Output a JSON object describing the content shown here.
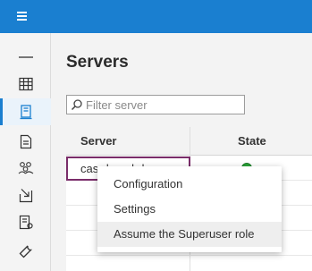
{
  "page": {
    "title": "Servers",
    "filter_placeholder": "Filter server"
  },
  "icons": {
    "menu": "hamburger-icon",
    "sidebar": [
      "collapse-icon",
      "table-icon",
      "server-icon",
      "document-icon",
      "users-icon",
      "download-icon",
      "report-icon",
      "wrench-icon"
    ]
  },
  "table": {
    "columns": [
      "Server",
      "State"
    ],
    "rows": [
      {
        "server": "cas-dev-ebde",
        "state_color": "#2aa437"
      }
    ]
  },
  "context_menu": {
    "items": [
      "Configuration",
      "Settings",
      "Assume the Superuser role"
    ]
  },
  "colors": {
    "topbar": "#1a7fd0",
    "accent": "#1a7fd0",
    "focus_border": "#7a2d6a",
    "status_ok": "#2aa437"
  }
}
